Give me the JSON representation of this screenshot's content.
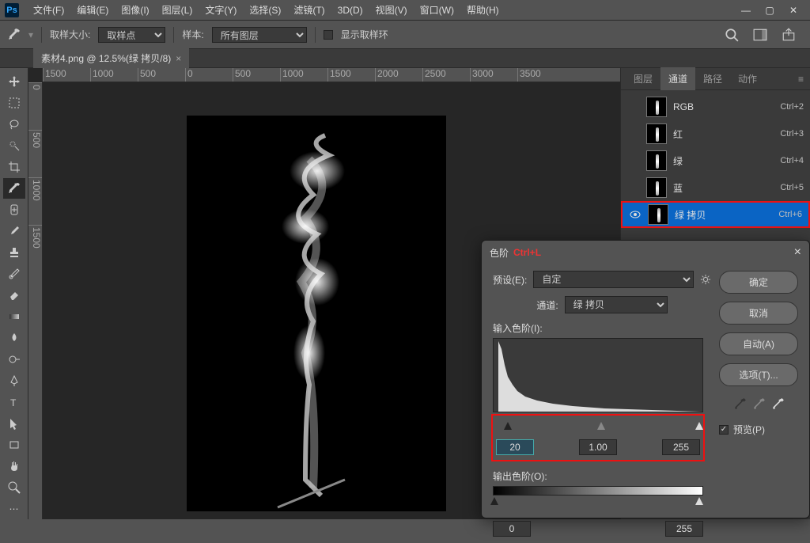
{
  "menu": {
    "items": [
      "文件(F)",
      "编辑(E)",
      "图像(I)",
      "图层(L)",
      "文字(Y)",
      "选择(S)",
      "滤镜(T)",
      "3D(D)",
      "视图(V)",
      "窗口(W)",
      "帮助(H)"
    ]
  },
  "optbar": {
    "sample_size_label": "取样大小:",
    "sample_size_value": "取样点",
    "sample_source_label": "样本:",
    "sample_source_value": "所有图层",
    "show_ring_label": "显示取样环"
  },
  "doc_tab": {
    "title": "素材4.png @ 12.5%(绿 拷贝/8)",
    "close": "×"
  },
  "ruler_h": [
    "1500",
    "1000",
    "500",
    "0",
    "500",
    "1000",
    "1500",
    "2000",
    "2500",
    "3000",
    "3500"
  ],
  "ruler_v": [
    "0",
    "500",
    "1000",
    "1500"
  ],
  "panel_tabs": {
    "layers": "图层",
    "channels": "通道",
    "paths": "路径",
    "actions": "动作"
  },
  "channels": [
    {
      "name": "RGB",
      "shortcut": "Ctrl+2",
      "selected": false,
      "visible": false
    },
    {
      "name": "红",
      "shortcut": "Ctrl+3",
      "selected": false,
      "visible": false
    },
    {
      "name": "绿",
      "shortcut": "Ctrl+4",
      "selected": false,
      "visible": false
    },
    {
      "name": "蓝",
      "shortcut": "Ctrl+5",
      "selected": false,
      "visible": false
    },
    {
      "name": "绿 拷贝",
      "shortcut": "Ctrl+6",
      "selected": true,
      "visible": true
    }
  ],
  "dialog": {
    "title": "色阶",
    "annot": "Ctrl+L",
    "preset_label": "预设(E):",
    "preset_value": "自定",
    "channel_label": "通道:",
    "channel_value": "绿 拷贝",
    "input_label": "输入色阶(I):",
    "input_black": "20",
    "input_gamma": "1.00",
    "input_white": "255",
    "output_label": "输出色阶(O):",
    "output_black": "0",
    "output_white": "255",
    "btn_ok": "确定",
    "btn_cancel": "取消",
    "btn_auto": "自动(A)",
    "btn_options": "选项(T)...",
    "preview_label": "预览(P)"
  }
}
